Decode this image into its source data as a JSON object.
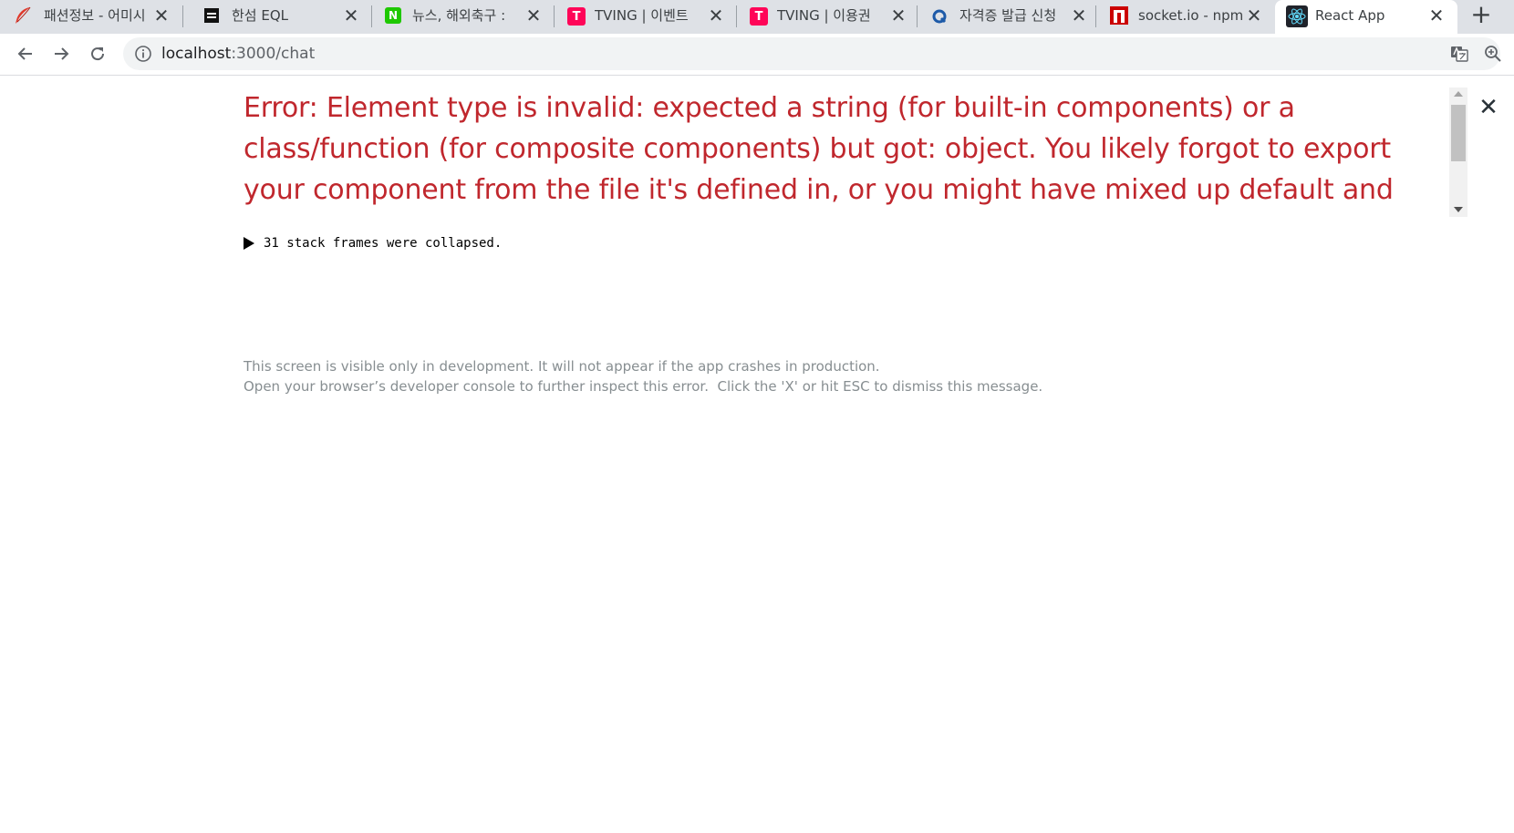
{
  "browser": {
    "tabs": [
      {
        "title": "패션정보 - 어미시",
        "favicon": "quill-red-icon",
        "favicon_color": "#e03a2c",
        "active": false
      },
      {
        "title": "한섬 EQL",
        "favicon": "eql-black-icon",
        "favicon_color": "#111111",
        "active": false
      },
      {
        "title": "뉴스, 해외축구 : ",
        "favicon": "naver-n-icon",
        "favicon_color": "#1ec800",
        "active": false
      },
      {
        "title": "TVING | 이벤트",
        "favicon": "tving-t-icon",
        "favicon_color": "#ff0558",
        "active": false
      },
      {
        "title": "TVING | 이용권",
        "favicon": "tving-t-icon",
        "favicon_color": "#ff0558",
        "active": false
      },
      {
        "title": "자격증 발급 신청",
        "favicon": "q-net-icon",
        "favicon_color": "#1d5aa8",
        "active": false
      },
      {
        "title": "socket.io - npm",
        "favicon": "npm-icon",
        "favicon_color": "#cb0000",
        "active": false
      },
      {
        "title": "React App",
        "favicon": "react-atom-icon",
        "favicon_color": "#61dafb",
        "active": true
      }
    ],
    "favicon_glyphs": {
      "eql": "EQL",
      "naver": "N",
      "tving": "T",
      "qnet": "Q"
    },
    "tab_close_glyph": "✕",
    "new_tab_glyph": "+",
    "url_host": "localhost",
    "url_path": ":3000/chat"
  },
  "overlay": {
    "error_message": "Error: Element type is invalid: expected a string (for built-in components) or a class/function (for composite components) but got: object. You likely forgot to export your component from the file it's defined in, or you might have mixed up default and named imports.",
    "stack_frames_label": "31 stack frames were collapsed.",
    "footer_line1": "This screen is visible only in development. It will not appear if the app crashes in production.",
    "footer_line2": "Open your browser’s developer console to further inspect this error.  Click the 'X' or hit ESC to dismiss this message.",
    "close_glyph": "✕",
    "error_color": "#c0272d"
  }
}
